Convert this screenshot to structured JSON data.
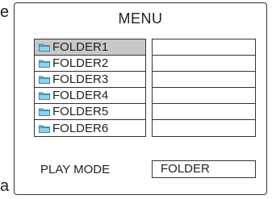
{
  "edge_text": {
    "top": "e",
    "bottom": "a"
  },
  "menu": {
    "title": "MENU",
    "folders": [
      {
        "label": "FOLDER1",
        "selected": true,
        "icon": "folder-icon"
      },
      {
        "label": "FOLDER2",
        "selected": false,
        "icon": "folder-icon"
      },
      {
        "label": "FOLDER3",
        "selected": false,
        "icon": "folder-icon"
      },
      {
        "label": "FOLDER4",
        "selected": false,
        "icon": "folder-icon"
      },
      {
        "label": "FOLDER5",
        "selected": false,
        "icon": "folder-icon"
      },
      {
        "label": "FOLDER6",
        "selected": false,
        "icon": "folder-icon"
      }
    ],
    "content_rows": [
      "",
      "",
      "",
      "",
      "",
      ""
    ],
    "play_mode": {
      "label": "PLAY MODE",
      "value": "FOLDER"
    }
  },
  "colors": {
    "selected_bg": "#c8c8c8",
    "folder_icon_fill": "#5fb3d9",
    "folder_icon_stroke": "#2a6f94",
    "border": "#333333"
  }
}
